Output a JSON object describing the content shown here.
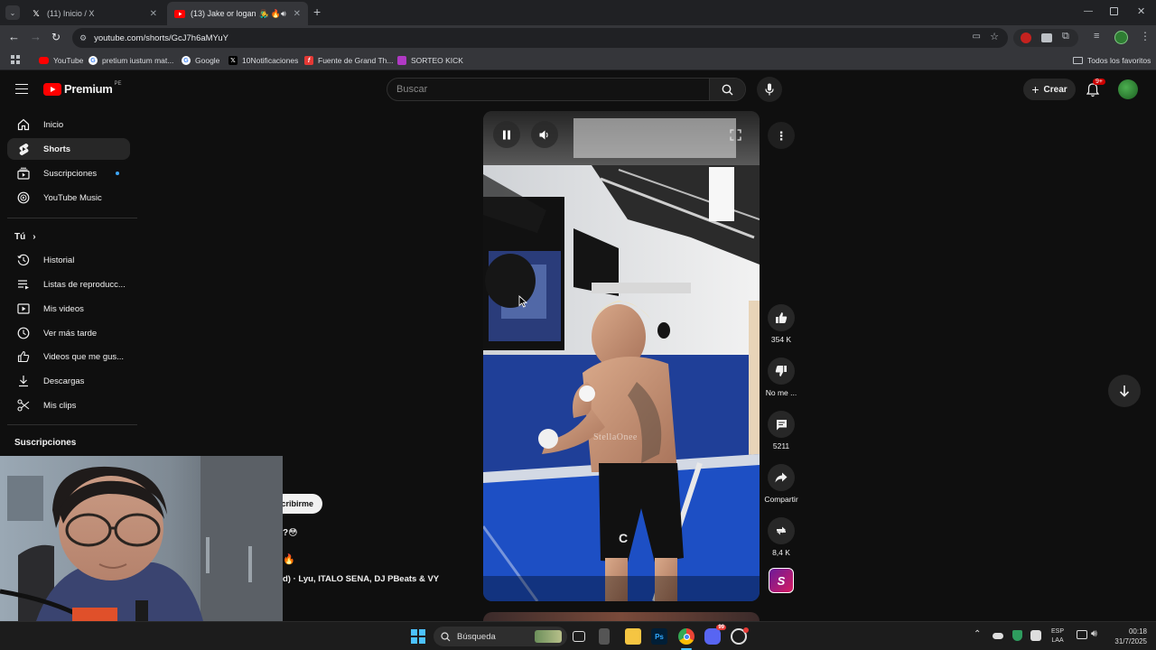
{
  "browser": {
    "tabs": [
      {
        "title": "(11) Inicio / X"
      },
      {
        "title": "(13) Jake or logan 👨‍🎤 🔥 -"
      }
    ],
    "url": "youtube.com/shorts/GcJ7h6aMYuY",
    "bookmarks": [
      {
        "label": "YouTube"
      },
      {
        "label": "pretium iustum mat..."
      },
      {
        "label": "Google"
      },
      {
        "label": "10Notificaciones"
      },
      {
        "label": "Fuente de Grand Th..."
      },
      {
        "label": "SORTEO KICK"
      }
    ],
    "all_bookmarks": "Todos los favoritos"
  },
  "youtube": {
    "logo_text": "Premium",
    "logo_region": "PE",
    "search_placeholder": "Buscar",
    "create_label": "Crear",
    "notif_badge": "9+"
  },
  "sidebar": {
    "main": [
      {
        "label": "Inicio"
      },
      {
        "label": "Shorts"
      },
      {
        "label": "Suscripciones"
      },
      {
        "label": "YouTube Music"
      }
    ],
    "you_heading": "Tú",
    "you": [
      {
        "label": "Historial"
      },
      {
        "label": "Listas de reproducc..."
      },
      {
        "label": "Mis videos"
      },
      {
        "label": "Ver más tarde"
      },
      {
        "label": "Videos que me gus..."
      },
      {
        "label": "Descargas"
      },
      {
        "label": "Mis clips"
      }
    ],
    "subs_heading": "Suscripciones"
  },
  "short": {
    "subscribe_partial": "cribirme",
    "title_partial": "?😳",
    "emoji_line": "🔥",
    "music_partial": "d) · Lyu, ITALO SENA, DJ PBeats & VY",
    "watermark": "StellaOnee",
    "actions": {
      "likes": "354 K",
      "dislike": "No me ...",
      "comments": "5211",
      "share": "Compartir",
      "remix": "8,4 K"
    }
  },
  "taskbar": {
    "search": "Búsqueda",
    "lang1": "ESP",
    "lang2": "LAA",
    "time": "00:18",
    "date": "31/7/2025",
    "discord_badge": "99"
  }
}
